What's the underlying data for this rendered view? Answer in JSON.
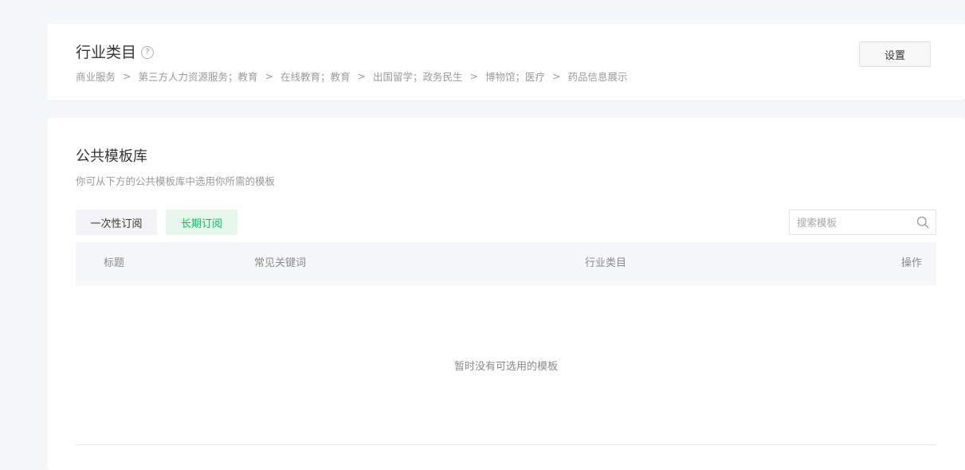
{
  "industry": {
    "title": "行业类目",
    "help_icon": "question-circle-icon",
    "help_glyph": "?",
    "path_separator": ">",
    "path": [
      "商业服务",
      "第三方人力资源服务；教育",
      "在线教育；教育",
      "出国留学；政务民生",
      "博物馆；医疗",
      "药品信息展示"
    ],
    "settings_label": "设置"
  },
  "library": {
    "title": "公共模板库",
    "description": "你可从下方的公共模板库中选用你所需的模板",
    "tabs": [
      {
        "label": "一次性订阅",
        "active": false
      },
      {
        "label": "长期订阅",
        "active": true
      }
    ],
    "search": {
      "placeholder": "搜索模板",
      "value": "",
      "icon": "search-icon"
    },
    "table": {
      "columns": [
        "标题",
        "常见关键词",
        "行业类目",
        "操作"
      ],
      "rows": [],
      "empty_text": "暂时没有可选用的模板"
    }
  },
  "colors": {
    "accent": "#07c160",
    "active_tab_bg": "#e7f6ec",
    "page_bg": "#f6f7f9"
  }
}
